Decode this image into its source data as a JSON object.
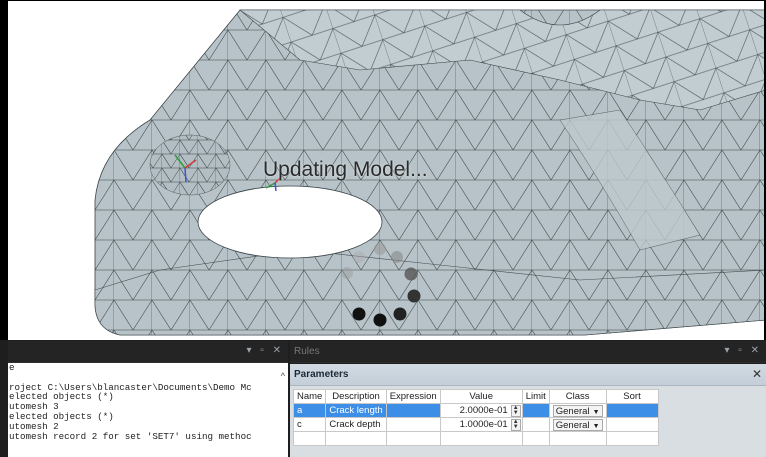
{
  "viewport": {
    "status_text": "Updating Model..."
  },
  "console": {
    "panel_title": "",
    "controls": "▾ ▫ ✕",
    "lines": [
      "e",
      "",
      "roject C:\\Users\\blancaster\\Documents\\Demo Mc",
      "elected objects (*)",
      "utomesh 3",
      "elected objects (*)",
      "utomesh 2",
      "utomesh record 2 for set 'SET7' using methoc"
    ],
    "scroll_up_glyph": "^"
  },
  "rules": {
    "panel_title": "Rules",
    "controls": "▾ ▫ ✕",
    "parameters": {
      "title": "Parameters",
      "close_glyph": "✕",
      "columns": [
        "Name",
        "Description",
        "Expression",
        "Value",
        "Limit",
        "Class",
        "Sort"
      ],
      "rows": [
        {
          "name": "a",
          "description": "Crack length",
          "expression": "",
          "value": "2.0000e-01",
          "limit": "",
          "class": "General",
          "sort": "",
          "selected": true
        },
        {
          "name": "c",
          "description": "Crack depth",
          "expression": "",
          "value": "1.0000e-01",
          "limit": "",
          "class": "General",
          "sort": "",
          "selected": false
        }
      ]
    }
  },
  "colors": {
    "mesh_fill": "#b7c3c8",
    "mesh_edges": "#3a4448",
    "selection": "#3d8ee6"
  }
}
